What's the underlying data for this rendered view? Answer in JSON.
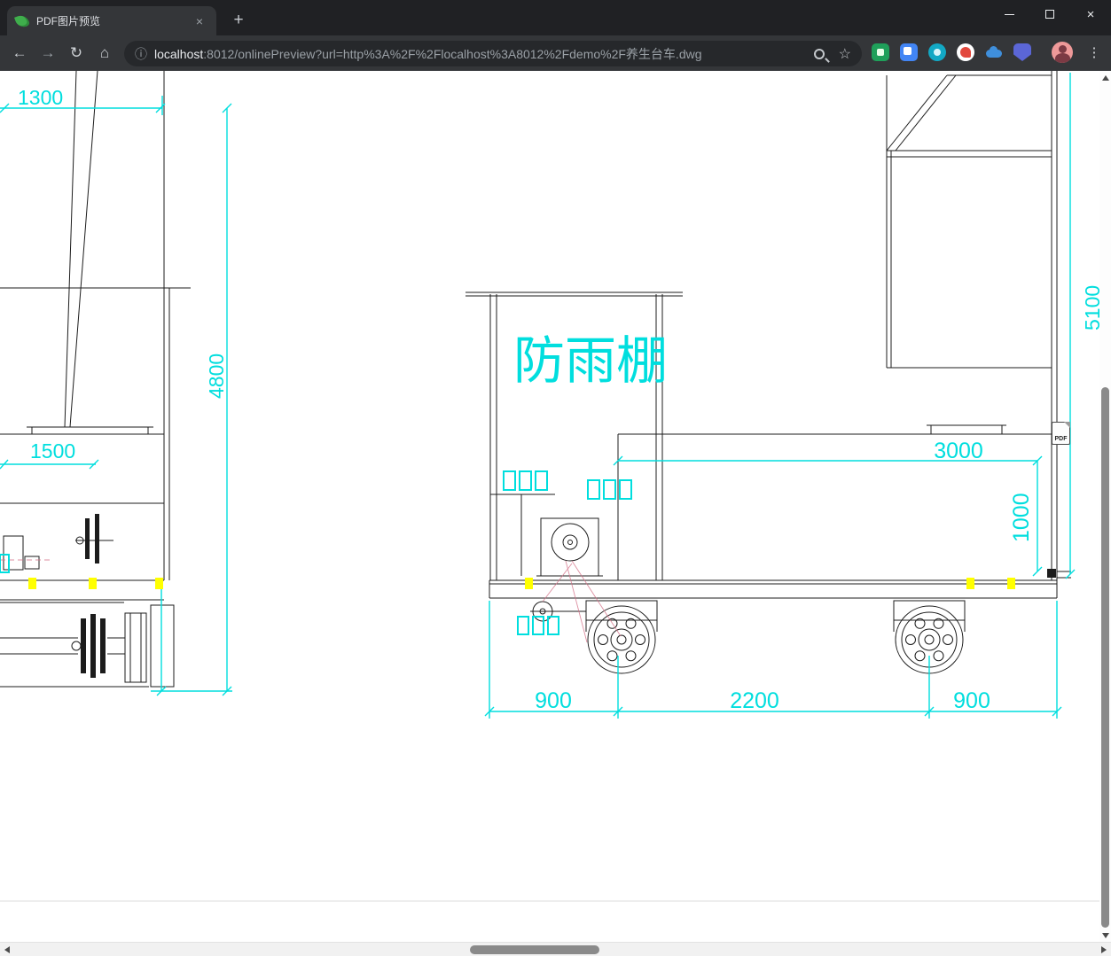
{
  "colors": {
    "cyan": "#00dede",
    "highlight": "#ffff00",
    "line": "#1c1c1c"
  },
  "tab": {
    "title": "PDF图片预览",
    "close": "×",
    "new_tab": "+"
  },
  "window_controls": {
    "close": "×"
  },
  "toolbar": {
    "back": "←",
    "forward": "→",
    "reload": "↻",
    "home": "⌂",
    "info": "ⓘ",
    "star": "☆",
    "menu": "⋮",
    "url_host": "localhost",
    "url_tail": ":8012/onlinePreview?url=http%3A%2F%2Flocalhost%3A8012%2Fdemo%2F养生台车.dwg"
  },
  "drawing": {
    "shelter_label": "防雨棚",
    "dim_top_left": "1300",
    "dim_height_left": "4800",
    "dim_width_left": "1500",
    "dim_height_right": "5100",
    "dim_platform_length": "3000",
    "dim_platform_height": "1000",
    "dim_span_left": "900",
    "dim_span_center": "2200",
    "dim_span_right": "900",
    "pdf_badge": "PDF"
  }
}
